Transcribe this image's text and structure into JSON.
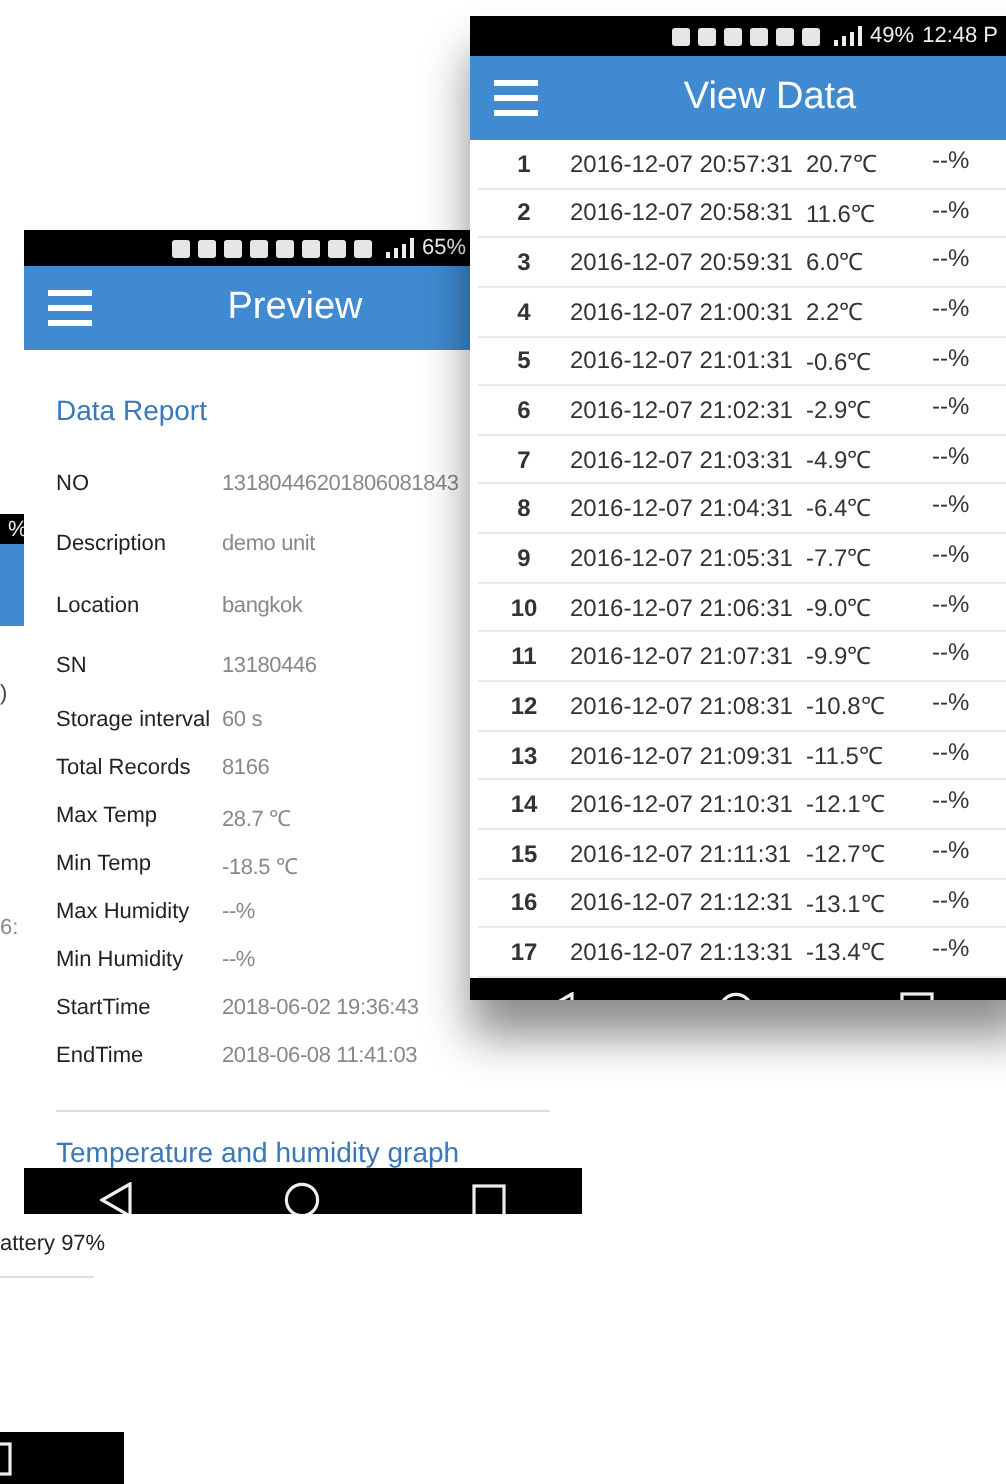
{
  "back_screen": {
    "status_battery": "%",
    "fragment_top": ")",
    "fragment_time": "6:",
    "battery_text": "attery 97%"
  },
  "preview_screen": {
    "status_battery": "65%",
    "title": "Preview",
    "section_title": "Data Report",
    "header_fields": [
      {
        "label": "NO",
        "value": "13180446201806081843"
      },
      {
        "label": "Description",
        "value": "demo unit"
      },
      {
        "label": "Location",
        "value": "bangkok"
      },
      {
        "label": "SN",
        "value": "13180446"
      }
    ],
    "detail_fields": [
      {
        "label": "Storage interval",
        "value": "60 s"
      },
      {
        "label": "Total Records",
        "value": "8166"
      },
      {
        "label": "Max Temp",
        "value": "28.7 ℃"
      },
      {
        "label": "Min Temp",
        "value": "-18.5 ℃"
      },
      {
        "label": "Max Humidity",
        "value": "--%"
      },
      {
        "label": "Min Humidity",
        "value": "--%"
      },
      {
        "label": "StartTime",
        "value": "2018-06-02 19:36:43"
      },
      {
        "label": "EndTime",
        "value": "2018-06-08 11:41:03"
      }
    ],
    "graph_title": "Temperature and humidity graph"
  },
  "view_data_screen": {
    "status_battery": "49%",
    "status_time": "12:48 P",
    "title": "View Data",
    "rows": [
      {
        "index": "1",
        "time": "2016-12-07 20:57:31",
        "temp": "20.7℃",
        "humidity": "--%"
      },
      {
        "index": "2",
        "time": "2016-12-07 20:58:31",
        "temp": "11.6℃",
        "humidity": "--%"
      },
      {
        "index": "3",
        "time": "2016-12-07 20:59:31",
        "temp": "6.0℃",
        "humidity": "--%"
      },
      {
        "index": "4",
        "time": "2016-12-07 21:00:31",
        "temp": "2.2℃",
        "humidity": "--%"
      },
      {
        "index": "5",
        "time": "2016-12-07 21:01:31",
        "temp": "-0.6℃",
        "humidity": "--%"
      },
      {
        "index": "6",
        "time": "2016-12-07 21:02:31",
        "temp": "-2.9℃",
        "humidity": "--%"
      },
      {
        "index": "7",
        "time": "2016-12-07 21:03:31",
        "temp": "-4.9℃",
        "humidity": "--%"
      },
      {
        "index": "8",
        "time": "2016-12-07 21:04:31",
        "temp": "-6.4℃",
        "humidity": "--%"
      },
      {
        "index": "9",
        "time": "2016-12-07 21:05:31",
        "temp": "-7.7℃",
        "humidity": "--%"
      },
      {
        "index": "10",
        "time": "2016-12-07 21:06:31",
        "temp": "-9.0℃",
        "humidity": "--%"
      },
      {
        "index": "11",
        "time": "2016-12-07 21:07:31",
        "temp": "-9.9℃",
        "humidity": "--%"
      },
      {
        "index": "12",
        "time": "2016-12-07 21:08:31",
        "temp": "-10.8℃",
        "humidity": "--%"
      },
      {
        "index": "13",
        "time": "2016-12-07 21:09:31",
        "temp": "-11.5℃",
        "humidity": "--%"
      },
      {
        "index": "14",
        "time": "2016-12-07 21:10:31",
        "temp": "-12.1℃",
        "humidity": "--%"
      },
      {
        "index": "15",
        "time": "2016-12-07 21:11:31",
        "temp": "-12.7℃",
        "humidity": "--%"
      },
      {
        "index": "16",
        "time": "2016-12-07 21:12:31",
        "temp": "-13.1℃",
        "humidity": "--%"
      },
      {
        "index": "17",
        "time": "2016-12-07 21:13:31",
        "temp": "-13.4℃",
        "humidity": "--%"
      }
    ]
  }
}
